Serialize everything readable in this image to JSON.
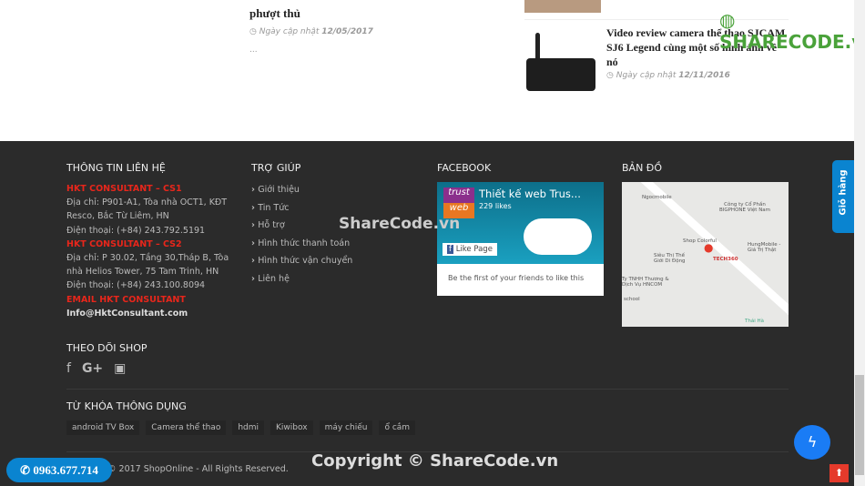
{
  "articles": [
    {
      "title_tail": "phượt thủ",
      "date_label": "Ngày cập nhật",
      "date": "12/05/2017",
      "excerpt": "..."
    },
    {
      "title": "Video review camera thể thao SJCAM SJ6 Legend cùng một số hình ảnh về nó",
      "date_label": "Ngày cập nhật",
      "date": "12/11/2016"
    }
  ],
  "watermark": {
    "logo": "SHARECODE.vn",
    "center": "ShareCode.vn",
    "copyright": "Copyright © ShareCode.vn"
  },
  "contact": {
    "heading": "THÔNG TIN LIÊN HỆ",
    "cs1": "HKT CONSULTANT – CS1",
    "addr1": "Địa chỉ: P901-A1, Tòa nhà OCT1, KĐT Resco, Bắc Từ Liêm, HN",
    "phone1": "Điện thoại: (+84) 243.792.5191",
    "cs2": "HKT CONSULTANT – CS2",
    "addr2": "Địa chỉ: P 30.02, Tầng 30,Tháp B, Tòa nhà Helios Tower, 75 Tam Trinh, HN",
    "phone2": "Điện thoại: (+84) 243.100.8094",
    "email_label": "EMAIL HKT CONSULTANT",
    "email": "Info@HktConsultant.com"
  },
  "help": {
    "heading": "TRỢ GIÚP",
    "items": [
      "Giới thiệu",
      "Tin Tức",
      "Hỗ trợ",
      "Hình thức thanh toán",
      "Hình thức vận chuyển",
      "Liên hệ"
    ]
  },
  "facebook": {
    "heading": "FACEBOOK",
    "page": "Thiết kế web Trus...",
    "likes": "229 likes",
    "like_btn": "Like Page",
    "friends": "Be the first of your friends to like this",
    "logo_top": "trust",
    "logo_bottom": "web"
  },
  "map": {
    "heading": "BẢN ĐỒ",
    "labels": [
      "Ngocmobile",
      "Công ty Cổ Phần BIGPHONE Việt Nam",
      "Shop Colorful",
      "HungMobile - Giá Trị Thật",
      "Siêu Thị Thế Giới Di Động",
      "TECH360",
      "Ty TNHH Thương & Dịch Vụ HNCOM",
      "school",
      "Thái Hà"
    ]
  },
  "follow": {
    "heading": "THEO DÕI SHOP",
    "icons": [
      "facebook-icon",
      "google-plus-icon",
      "youtube-icon"
    ]
  },
  "keywords": {
    "heading": "TỪ KHÓA THÔNG DỤNG",
    "tags": [
      "android TV Box",
      "Camera thể thao",
      "hdmi",
      "Kiwibox",
      "máy chiếu",
      "ổ cắm"
    ]
  },
  "copyright": "© 2017 ShopOnline - All Rights Reserved.",
  "hotline": "0963.677.714",
  "cart_tab": "Giỏ hàng",
  "colors": {
    "footer": "#2b2b2b",
    "accent_red": "#e8261b",
    "blue": "#0a84d0",
    "messenger": "#1a7cf5",
    "totop": "#e53a2b"
  }
}
